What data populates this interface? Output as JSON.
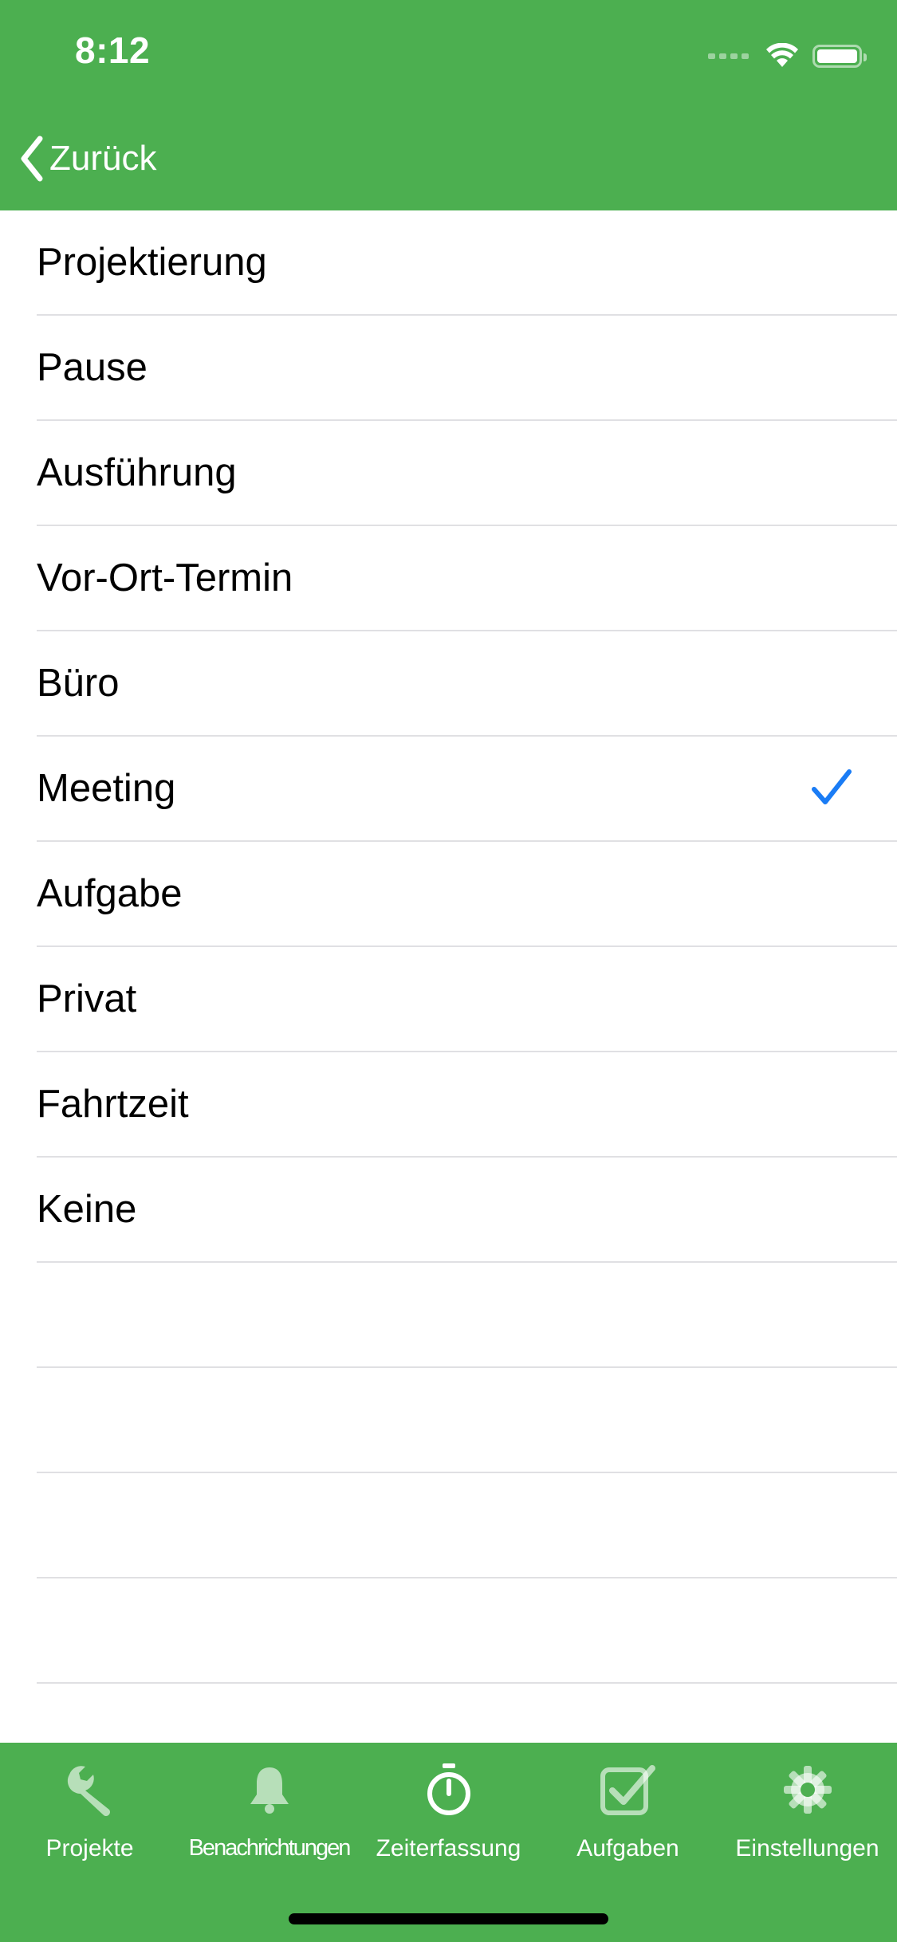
{
  "status_bar": {
    "time": "8:12"
  },
  "nav": {
    "back_label": "Zurück"
  },
  "list": {
    "items": [
      {
        "label": "Projektierung",
        "selected": false
      },
      {
        "label": "Pause",
        "selected": false
      },
      {
        "label": "Ausführung",
        "selected": false
      },
      {
        "label": "Vor-Ort-Termin",
        "selected": false
      },
      {
        "label": "Büro",
        "selected": false
      },
      {
        "label": "Meeting",
        "selected": true
      },
      {
        "label": "Aufgabe",
        "selected": false
      },
      {
        "label": "Privat",
        "selected": false
      },
      {
        "label": "Fahrtzeit",
        "selected": false
      },
      {
        "label": "Keine",
        "selected": false
      }
    ]
  },
  "tabbar": {
    "tabs": [
      {
        "label": "Projekte",
        "icon": "wrench-icon"
      },
      {
        "label": "Benachrichtungen",
        "icon": "bell-icon"
      },
      {
        "label": "Zeiterfassung",
        "icon": "stopwatch-icon"
      },
      {
        "label": "Aufgaben",
        "icon": "checkbox-icon"
      },
      {
        "label": "Einstellungen",
        "icon": "gear-icon"
      }
    ]
  },
  "colors": {
    "brand_green": "#4caf50",
    "checkmark_blue": "#1a7cf5",
    "separator": "#e0e0e3"
  }
}
